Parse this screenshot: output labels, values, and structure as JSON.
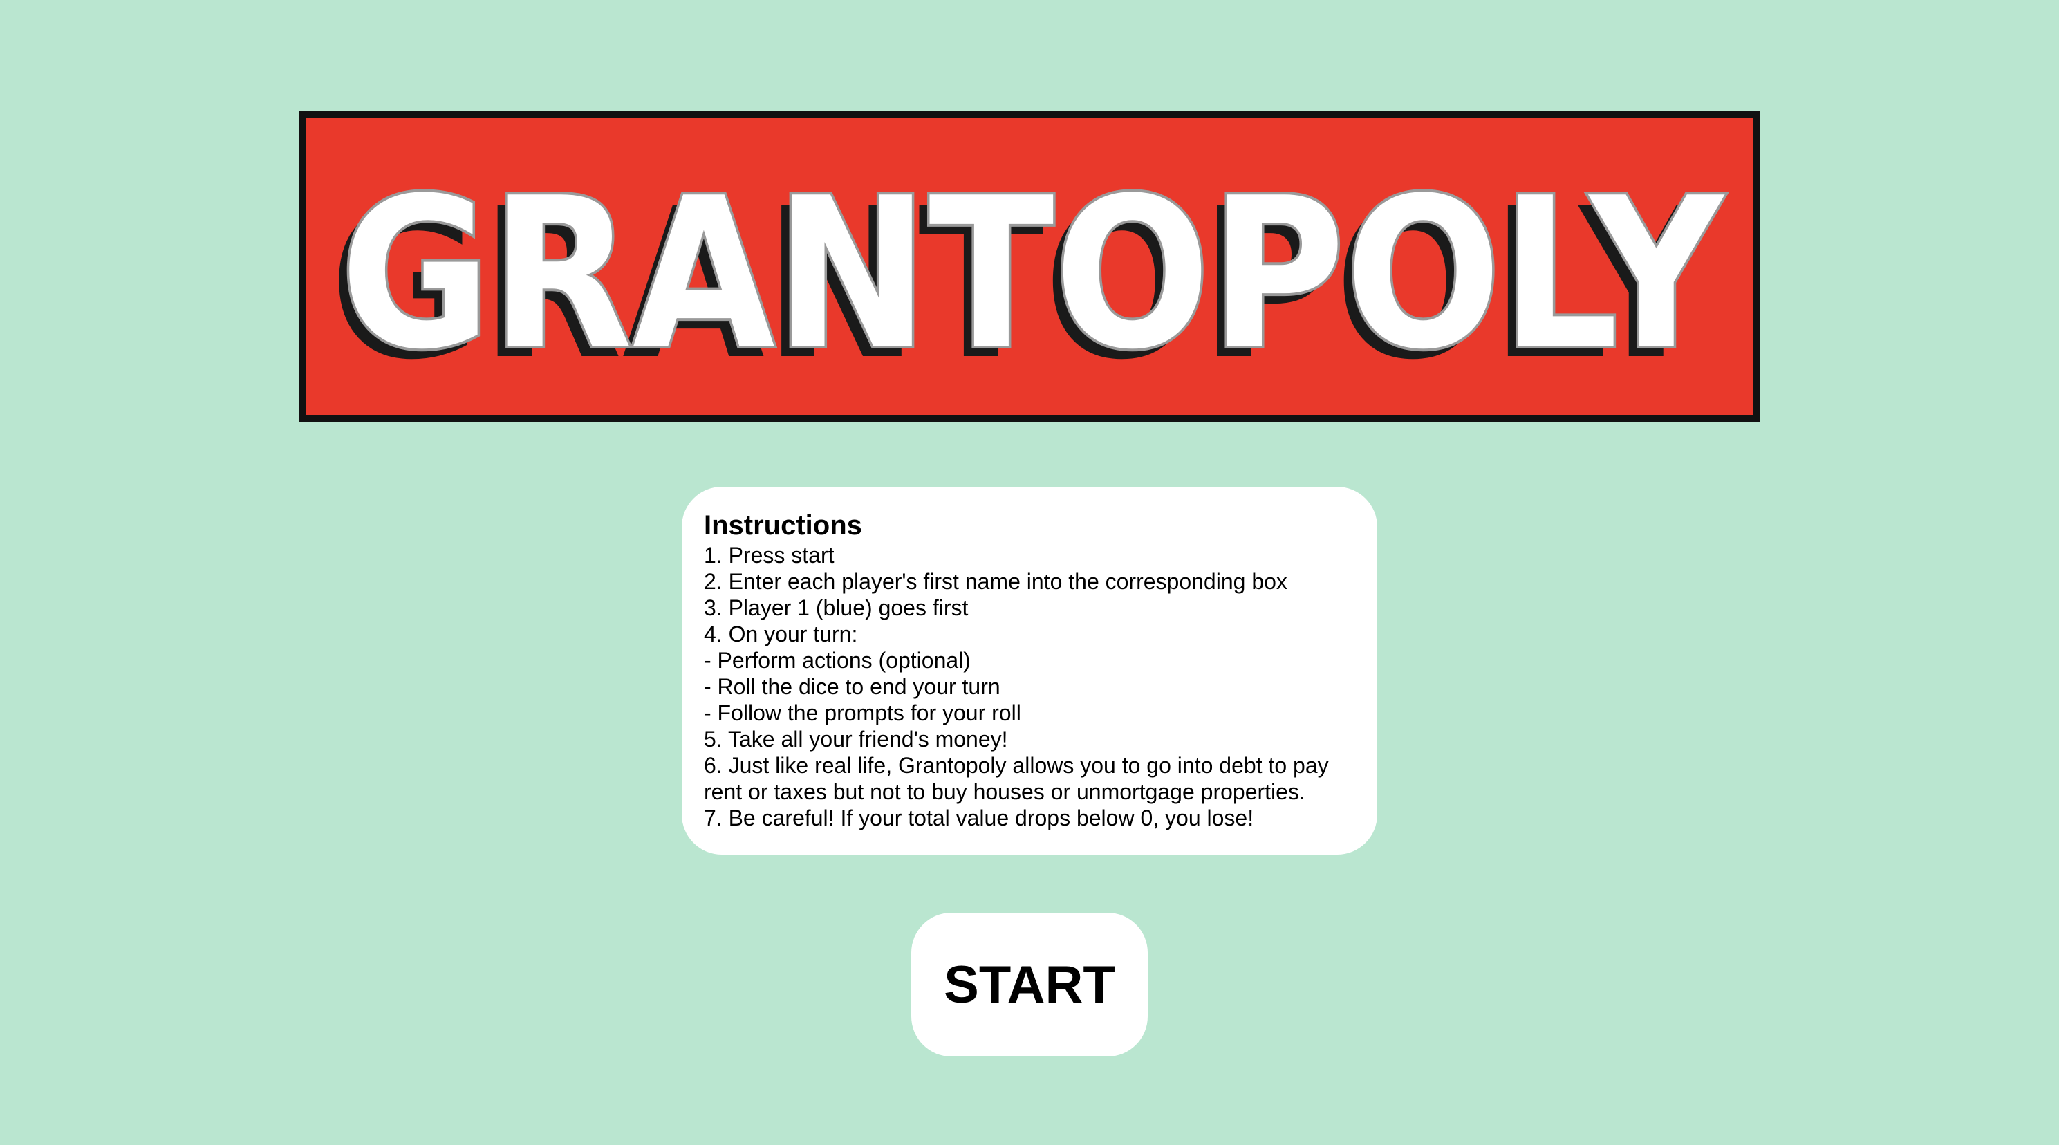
{
  "colors": {
    "background": "#bae6d0",
    "banner": "#e9392b",
    "banner_border": "#111111",
    "logo_fill": "#ffffff",
    "logo_outline": "#9a9a9a",
    "logo_shadow": "#1a1a1a",
    "panel": "#ffffff",
    "text": "#000000"
  },
  "logo": {
    "text": "GRANTOPOLY"
  },
  "instructions": {
    "title": "Instructions",
    "items": [
      "1. Press start",
      "2. Enter each player's first name into the corresponding box",
      "3. Player 1 (blue) goes first",
      "4. On your turn:",
      "- Perform actions (optional)",
      "- Roll the dice to end your turn",
      "- Follow the prompts for your roll",
      "5. Take all your friend's money!",
      "6. Just like real life, Grantopoly allows you to go into debt to pay rent or taxes but not to buy houses or unmortgage properties.",
      "7. Be careful! If your total value drops below 0, you lose!"
    ]
  },
  "start_button": {
    "label": "START"
  }
}
